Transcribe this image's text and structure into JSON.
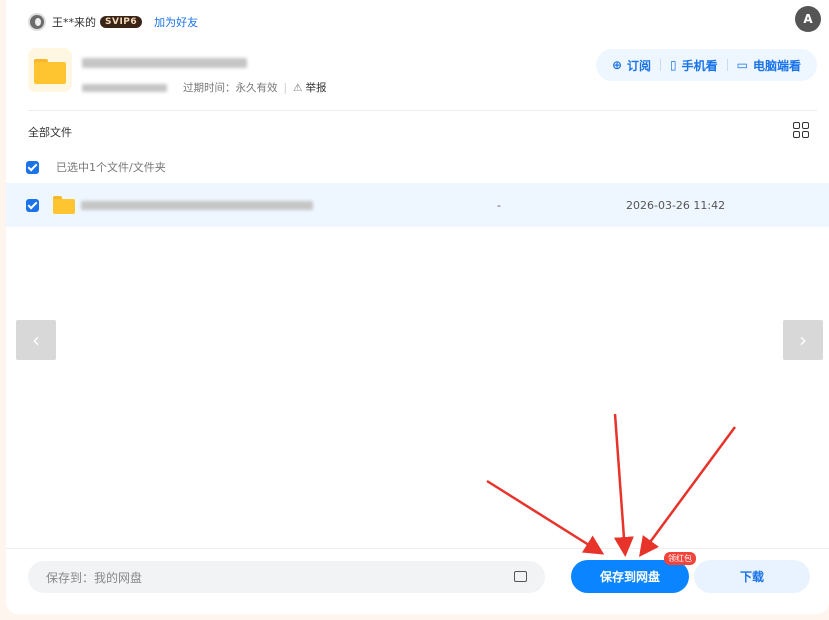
{
  "header": {
    "sharer_name": "王**来的",
    "vip_label": "SVIP6",
    "add_friend": "加为好友",
    "translate_icon": "translate-icon"
  },
  "share": {
    "expire_label": "过期时间：永久有效",
    "report": "举报",
    "actions": {
      "subscribe": "订阅",
      "mobile": "手机看",
      "desktop": "电脑端看"
    }
  },
  "list": {
    "title": "全部文件",
    "selected_text": "已选中1个文件/文件夹",
    "rows": [
      {
        "size": "-",
        "time": "2026-03-26 11:42"
      }
    ]
  },
  "footer": {
    "save_path": "保存到：我的网盘",
    "save_button": "保存到网盘",
    "red_badge": "领红包",
    "download_button": "下载"
  },
  "colors": {
    "accent": "#0a84ff",
    "badge_red": "#f3443c",
    "arrow_red": "#e8332a"
  }
}
